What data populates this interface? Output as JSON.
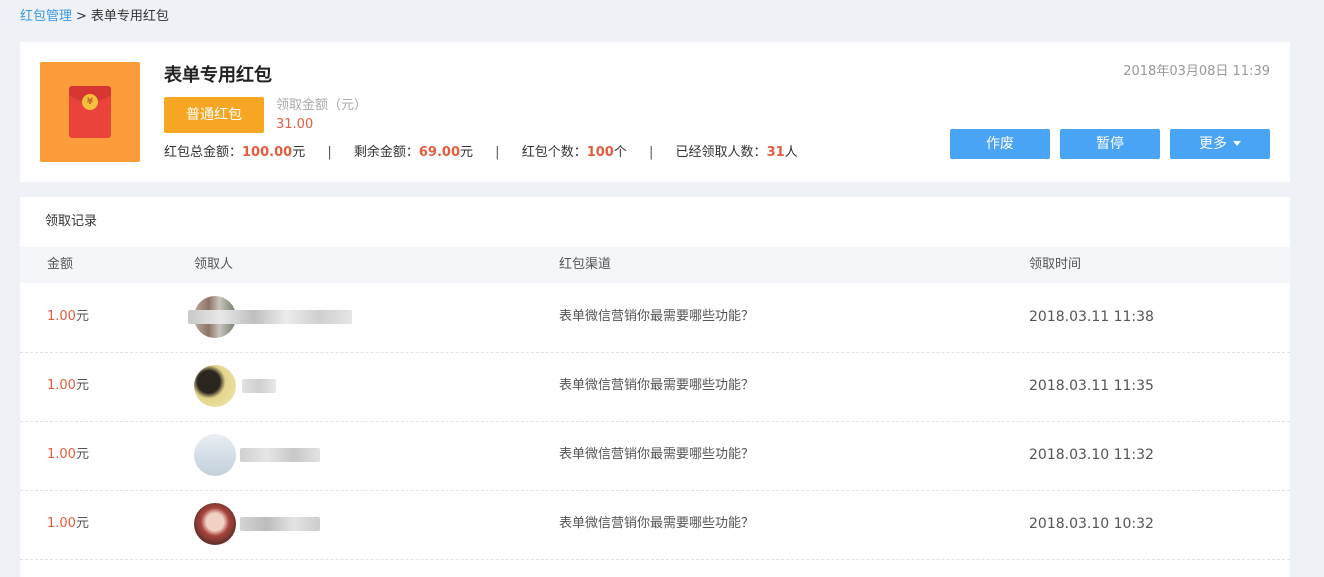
{
  "breadcrumb": {
    "root": "红包管理",
    "separator": ">",
    "current": "表单专用红包"
  },
  "packet": {
    "title": "表单专用红包",
    "type_button": "普通红包",
    "claim_label": "领取金额（元）",
    "claim_value": "31.00",
    "created_at": "2018年03月08日 11:39",
    "stats": {
      "total_label": "红包总金额：",
      "total_value": "100.00",
      "total_unit": "元",
      "remaining_label": "剩余金额：",
      "remaining_value": "69.00",
      "remaining_unit": "元",
      "count_label": "红包个数：",
      "count_value": "100",
      "count_unit": "个",
      "claimed_label": "已经领取人数：",
      "claimed_value": "31",
      "claimed_unit": "人",
      "divider": "|"
    },
    "actions": {
      "void": "作废",
      "pause": "暂停",
      "more": "更多"
    }
  },
  "records": {
    "title": "领取记录",
    "columns": {
      "amount": "金额",
      "user": "领取人",
      "channel": "红包渠道",
      "time": "领取时间"
    },
    "rows": [
      {
        "amount": "1.00",
        "unit": "元",
        "channel": "表单微信营销你最需要哪些功能？",
        "time": "2018.03.11 11:38"
      },
      {
        "amount": "1.00",
        "unit": "元",
        "channel": "表单微信营销你最需要哪些功能？",
        "time": "2018.03.11 11:35"
      },
      {
        "amount": "1.00",
        "unit": "元",
        "channel": "表单微信营销你最需要哪些功能？",
        "time": "2018.03.10 11:32"
      },
      {
        "amount": "1.00",
        "unit": "元",
        "channel": "表单微信营销你最需要哪些功能？",
        "time": "2018.03.10 10:32"
      }
    ]
  },
  "colors": {
    "link": "#3a9ae8",
    "accent_orange": "#f6a623",
    "icon_bg": "#fc9c3a",
    "highlight_red": "#e45d3e",
    "action_blue": "#4aa4f5"
  },
  "icons": {
    "packet": "red-envelope-icon",
    "more": "caret-down-icon"
  }
}
